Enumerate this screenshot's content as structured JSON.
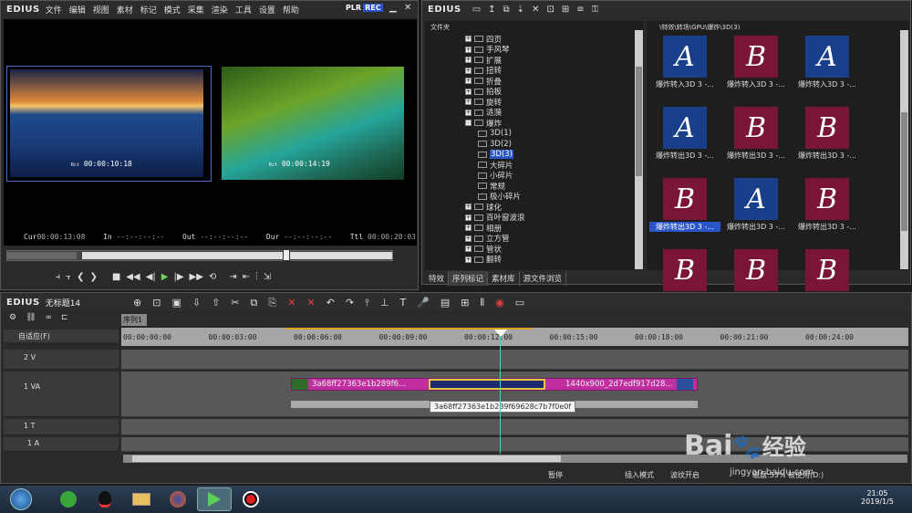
{
  "app": {
    "logo": "EDIUS"
  },
  "menu": [
    "文件",
    "编辑",
    "视图",
    "素材",
    "标记",
    "模式",
    "采集",
    "渲染",
    "工具",
    "设置",
    "帮助"
  ],
  "player": {
    "plr_label": "PLR",
    "rec_label": "REC"
  },
  "monitor": {
    "left_timecode": "00:00:10:18",
    "right_timecode": "00:00:14:19",
    "tc_prefix": "Rct",
    "cur_label": "Cur",
    "cur_value": "00:00:13:08",
    "in_label": "In",
    "in_value": "--:--:--:--",
    "out_label": "Out",
    "out_value": "--:--:--:--",
    "dur_label": "Dur",
    "dur_value": "--:--:--:--",
    "ttl_label": "Ttl",
    "ttl_value": "00:00:20:03"
  },
  "effects_panel": {
    "logo": "EDIUS",
    "tree_header": "文件夹",
    "path": "\\特效\\转场\\GPU\\爆炸\\3D(3)",
    "tree": [
      {
        "label": "四页",
        "level": 1,
        "expander": "+"
      },
      {
        "label": "手风琴",
        "level": 1,
        "expander": "+"
      },
      {
        "label": "扩展",
        "level": 1,
        "expander": "+"
      },
      {
        "label": "扭转",
        "level": 1,
        "expander": "+"
      },
      {
        "label": "折叠",
        "level": 1,
        "expander": "+"
      },
      {
        "label": "拍板",
        "level": 1,
        "expander": "+"
      },
      {
        "label": "旋转",
        "level": 1,
        "expander": "+"
      },
      {
        "label": "涟漪",
        "level": 1,
        "expander": "+"
      },
      {
        "label": "爆炸",
        "level": 1,
        "expander": "-"
      },
      {
        "label": "3D(1)",
        "level": 2,
        "expander": ""
      },
      {
        "label": "3D(2)",
        "level": 2,
        "expander": ""
      },
      {
        "label": "3D(3)",
        "level": 2,
        "expander": "",
        "selected": true
      },
      {
        "label": "大碎片",
        "level": 2,
        "expander": ""
      },
      {
        "label": "小碎片",
        "level": 2,
        "expander": ""
      },
      {
        "label": "常规",
        "level": 2,
        "expander": ""
      },
      {
        "label": "极小碎片",
        "level": 2,
        "expander": ""
      },
      {
        "label": "球化",
        "level": 1,
        "expander": "+"
      },
      {
        "label": "百叶窗波浪",
        "level": 1,
        "expander": "+"
      },
      {
        "label": "相册",
        "level": 1,
        "expander": "+"
      },
      {
        "label": "立方管",
        "level": 1,
        "expander": "+"
      },
      {
        "label": "管状",
        "level": 1,
        "expander": "+"
      },
      {
        "label": "翻转",
        "level": 1,
        "expander": "+"
      }
    ],
    "tabs": [
      "特效",
      "序列标记",
      "素材库",
      "源文件浏览"
    ],
    "thumbs": [
      {
        "label": "爆炸转入3D 3 -...",
        "letter": "A"
      },
      {
        "label": "爆炸转入3D 3 -...",
        "letter": "B"
      },
      {
        "label": "爆炸转入3D 3 -...",
        "letter": "A"
      },
      {
        "label": "爆炸转出3D 3 -...",
        "letter": "A"
      },
      {
        "label": "爆炸转出3D 3 -...",
        "letter": "B"
      },
      {
        "label": "爆炸转出3D 3 -...",
        "letter": "B"
      },
      {
        "label": "爆炸转出3D 3 -...",
        "letter": "B",
        "selected": true
      },
      {
        "label": "爆炸转出3D 3 -...",
        "letter": "A"
      },
      {
        "label": "爆炸转出3D 3 -...",
        "letter": "B"
      },
      {
        "label": "",
        "letter": "B"
      },
      {
        "label": "",
        "letter": "B"
      },
      {
        "label": "",
        "letter": "B"
      }
    ]
  },
  "timeline": {
    "logo": "EDIUS",
    "project_name": "无标题14",
    "sequence_tab": "序列1",
    "fit_label": "自适应(F)",
    "ruler": [
      "00:00:00:00",
      "00:00:03:00",
      "00:00:06:00",
      "00:00:09:00",
      "00:00:12:00",
      "00:00:15:00",
      "00:00:18:00",
      "00:00:21:00",
      "00:00:24:00"
    ],
    "tracks": [
      {
        "label": "2 V"
      },
      {
        "label": "1 VA"
      },
      {
        "label": "1 T"
      },
      {
        "label": "1 A"
      }
    ],
    "clip1": "3a68ff27363e1b289f6...",
    "clip2": "1440x900_2d7edf917d28...",
    "tooltip": "3a68ff27363e1b289f69628c7b7f0e0f",
    "status": {
      "pause": "暂停",
      "insert": "插入模式",
      "ripple": "波纹开启",
      "disk": "磁盘:53% 被使用(D:)"
    }
  },
  "taskbar": {
    "time": "21:05",
    "date": "2019/1/5"
  },
  "watermark": {
    "brand": "Bai",
    "brand_cn": "经验",
    "url": "jingyan.baidu.com"
  }
}
